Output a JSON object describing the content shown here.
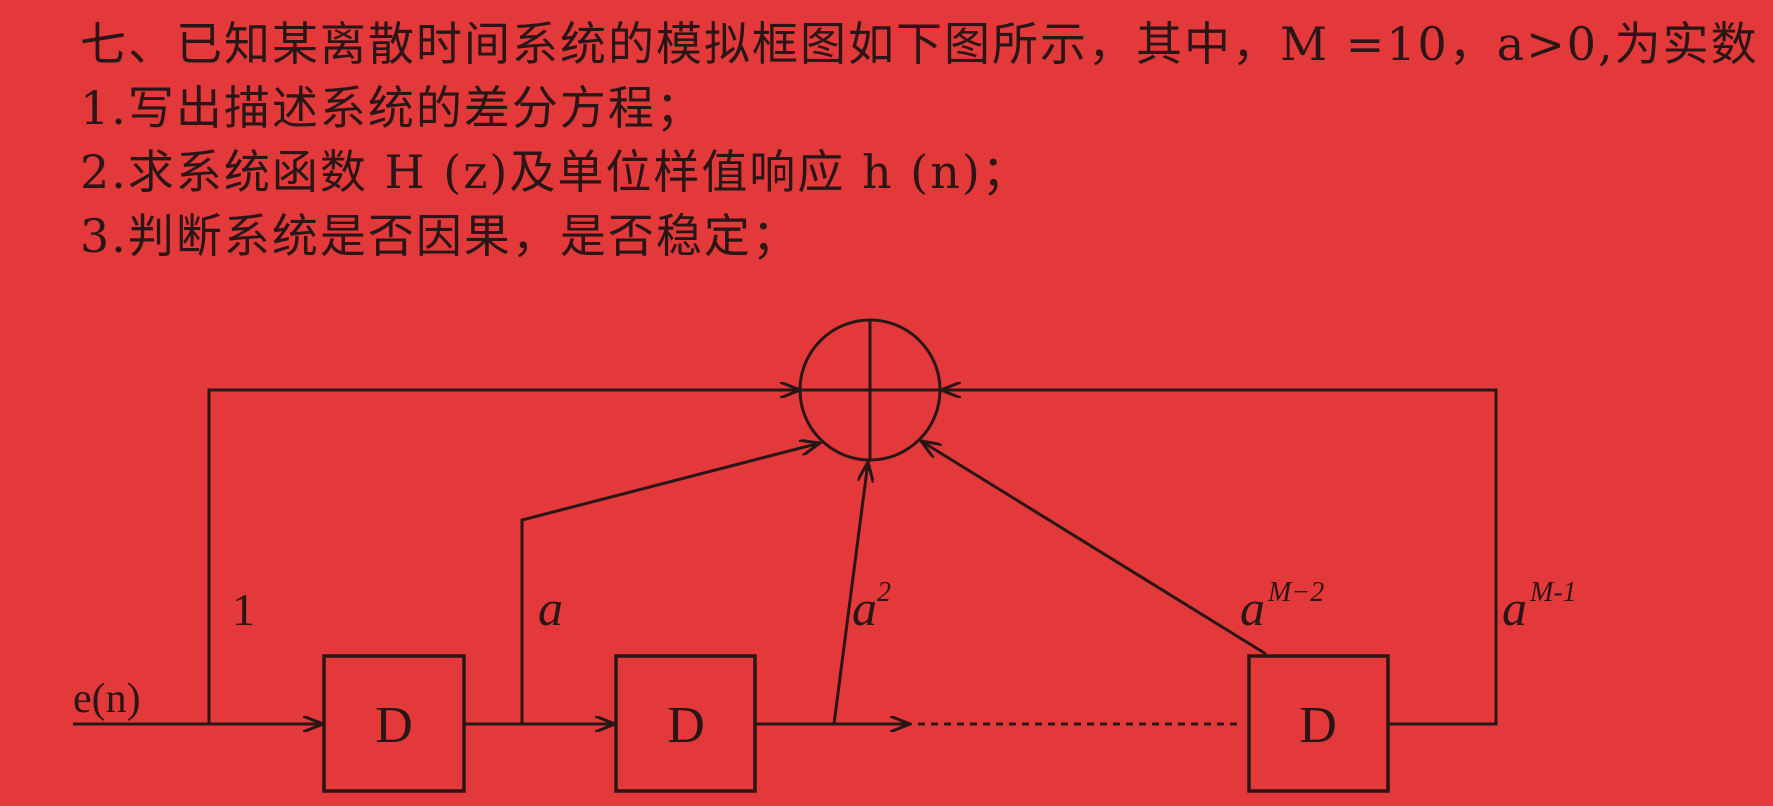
{
  "colors": {
    "background": "#e4393a",
    "ink": "#2a1616"
  },
  "question": {
    "heading": "七、已知某离散时间系统的模拟框图如下图所示，其中，M =10，a>0,为实数",
    "parts": [
      "1.写出描述系统的差分方程；",
      "2.求系统函数 H (z)及单位样值响应 h (n)；",
      "3.判断系统是否因果，是否稳定；"
    ]
  },
  "diagram": {
    "input_label": "e(n)",
    "delays": [
      "D",
      "D",
      "D"
    ],
    "gains": [
      {
        "base": "1"
      },
      {
        "base": "a"
      },
      {
        "base": "a",
        "exponent": "2"
      },
      {
        "base": "a",
        "exponent": "M−2"
      },
      {
        "base": "a",
        "exponent": "M-1"
      }
    ]
  }
}
